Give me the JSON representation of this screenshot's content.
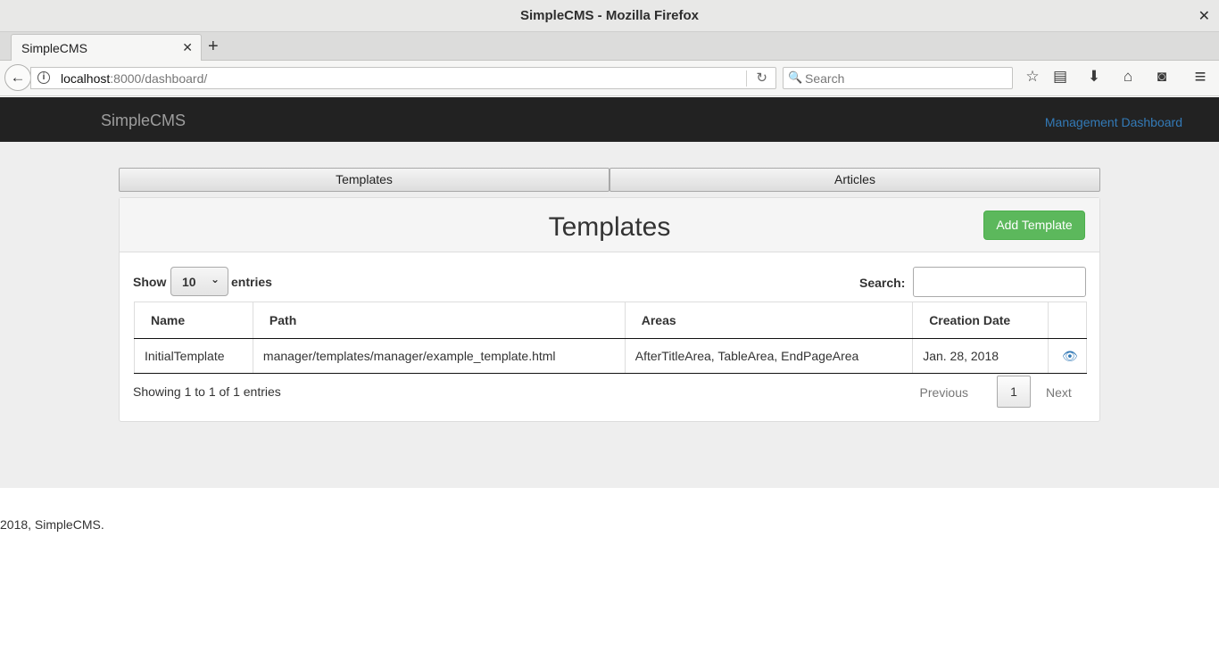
{
  "window": {
    "title": "SimpleCMS - Mozilla Firefox",
    "close_glyph": "✕"
  },
  "browser": {
    "tab_label": "SimpleCMS",
    "tab_close_glyph": "✕",
    "new_tab_glyph": "+",
    "back_glyph": "←",
    "info_glyph": "i",
    "url_host": "localhost",
    "url_path": ":8000/dashboard/",
    "reload_glyph": "↻",
    "search_placeholder": "Search",
    "search_glyph": "🔍",
    "icons": {
      "bookmark": "☆",
      "reader": "▤",
      "download": "⬇",
      "home": "⌂",
      "pocket": "◙",
      "menu": "≡"
    }
  },
  "site": {
    "brand": "SimpleCMS",
    "nav_link": "Management Dashboard"
  },
  "section_tabs": {
    "templates": "Templates",
    "articles": "Articles"
  },
  "panel": {
    "title": "Templates",
    "add_button": "Add Template"
  },
  "table_controls": {
    "show_label": "Show",
    "entries_label": "entries",
    "page_length": "10",
    "select_chevron": "⌄",
    "search_label": "Search:",
    "search_value": ""
  },
  "table": {
    "columns": [
      "Name",
      "Path",
      "Areas",
      "Creation Date",
      ""
    ],
    "rows": [
      {
        "name": "InitialTemplate",
        "path": "manager/templates/manager/example_template.html",
        "areas": "AfterTitleArea, TableArea, EndPageArea",
        "date": "Jan. 28, 2018",
        "action_icon": "👁"
      }
    ]
  },
  "pagination": {
    "info": "Showing 1 to 1 of 1 entries",
    "previous": "Previous",
    "current_page": "1",
    "next": "Next"
  },
  "footer": {
    "text": "2018, SimpleCMS."
  }
}
